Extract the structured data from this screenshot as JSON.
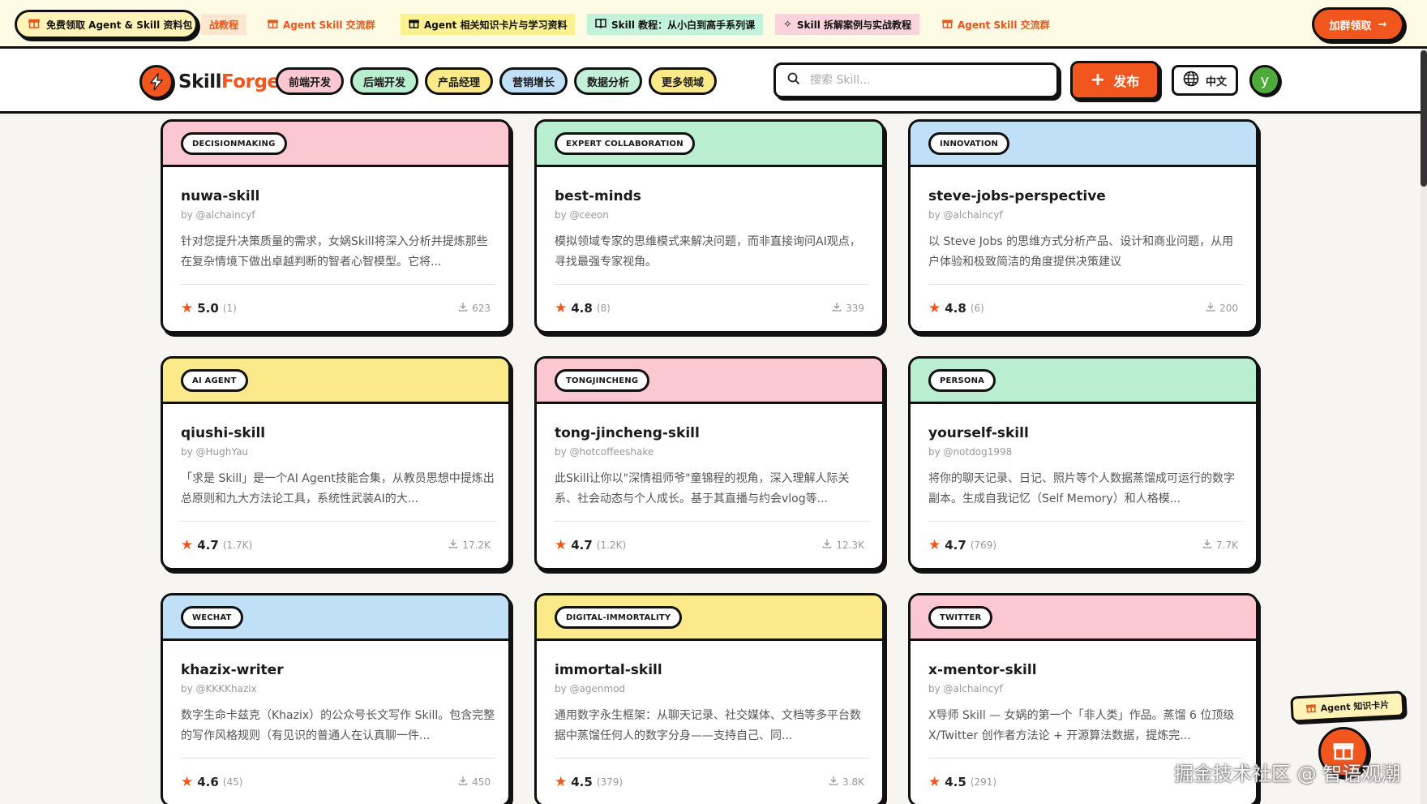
{
  "promo": {
    "primary_label": "免费领取 Agent & Skill 资料包",
    "items": [
      {
        "label": "战教程",
        "icon": "gift-icon",
        "bg": "#fde7d0",
        "color": "#e8551e"
      },
      {
        "label": "Agent Skill 交流群",
        "icon": "gift-icon",
        "bg": "transparent",
        "color": "#e8551e"
      },
      {
        "label": "Agent 相关知识卡片与学习资料",
        "icon": "gift-icon",
        "bg": "#fbf191",
        "color": "#111111"
      },
      {
        "label": "Skill 教程：从小白到高手系列课",
        "icon": "book-icon",
        "bg": "#c3f1d9",
        "color": "#111111"
      },
      {
        "label": "Skill 拆解案例与实战教程",
        "icon": "sparkle-icon",
        "bg": "#fbd3dc",
        "color": "#111111"
      },
      {
        "label": "Agent Skill 交流群",
        "icon": "gift-icon",
        "bg": "transparent",
        "color": "#e8551e"
      }
    ],
    "cta_label": "加群领取"
  },
  "header": {
    "logo_part1": "Skill",
    "logo_part2": "Forge",
    "categories": [
      {
        "label": "前端开发",
        "bg": "#fbc8d2"
      },
      {
        "label": "后端开发",
        "bg": "#b9eed1"
      },
      {
        "label": "产品经理",
        "bg": "#fbe98a"
      },
      {
        "label": "营销增长",
        "bg": "#bfe0f7"
      },
      {
        "label": "数据分析",
        "bg": "#c3f0d6"
      },
      {
        "label": "更多领域",
        "bg": "#fbe98a"
      }
    ],
    "search_placeholder": "搜索 Skill...",
    "publish_label": "发布",
    "lang_label": "中文",
    "avatar_initial": "y"
  },
  "cards": [
    {
      "tag": "DECISIONMAKING",
      "color": "#fbc8d2",
      "title": "nuwa-skill",
      "author": "by @alchaincyf",
      "desc": "针对您提升决策质量的需求，女娲Skill将深入分析并提炼那些在复杂情境下做出卓越判断的智者心智模型。它将...",
      "rating": "5.0",
      "count": "(1)",
      "downloads": "623"
    },
    {
      "tag": "EXPERT COLLABORATION",
      "color": "#b9eed1",
      "title": "best-minds",
      "author": "by @ceeon",
      "desc": "模拟领域专家的思维模式来解决问题，而非直接询问AI观点，寻找最强专家视角。",
      "rating": "4.8",
      "count": "(8)",
      "downloads": "339"
    },
    {
      "tag": "INNOVATION",
      "color": "#bfe0f7",
      "title": "steve-jobs-perspective",
      "author": "by @alchaincyf",
      "desc": "以 Steve Jobs 的思维方式分析产品、设计和商业问题，从用户体验和极致简洁的角度提供决策建议",
      "rating": "4.8",
      "count": "(6)",
      "downloads": "200"
    },
    {
      "tag": "AI AGENT",
      "color": "#fbe98a",
      "title": "qiushi-skill",
      "author": "by @HughYau",
      "desc": "「求是 Skill」是一个AI Agent技能合集，从教员思想中提炼出总原则和九大方法论工具，系统性武装AI的大...",
      "rating": "4.7",
      "count": "(1.7K)",
      "downloads": "17.2K"
    },
    {
      "tag": "TONGJINCHENG",
      "color": "#fbc8d2",
      "title": "tong-jincheng-skill",
      "author": "by @hotcoffeeshake",
      "desc": "此Skill让你以\"深情祖师爷\"童锦程的视角，深入理解人际关系、社会动态与个人成长。基于其直播与约会vlog等...",
      "rating": "4.7",
      "count": "(1.2K)",
      "downloads": "12.3K"
    },
    {
      "tag": "PERSONA",
      "color": "#b9eed1",
      "title": "yourself-skill",
      "author": "by @notdog1998",
      "desc": "将你的聊天记录、日记、照片等个人数据蒸馏成可运行的数字副本。生成自我记忆（Self Memory）和人格模...",
      "rating": "4.7",
      "count": "(769)",
      "downloads": "7.7K"
    },
    {
      "tag": "WECHAT",
      "color": "#bfe0f7",
      "title": "khazix-writer",
      "author": "by @KKKKhazix",
      "desc": "数字生命卡兹克（Khazix）的公众号长文写作 Skill。包含完整的写作风格规则（有见识的普通人在认真聊一件...",
      "rating": "4.6",
      "count": "(45)",
      "downloads": "450"
    },
    {
      "tag": "DIGITAL-IMMORTALITY",
      "color": "#fbe98a",
      "title": "immortal-skill",
      "author": "by @agenmod",
      "desc": "通用数字永生框架：从聊天记录、社交媒体、文档等多平台数据中蒸馏任何人的数字分身——支持自己、同...",
      "rating": "4.5",
      "count": "(379)",
      "downloads": "3.8K"
    },
    {
      "tag": "TWITTER",
      "color": "#fbc8d2",
      "title": "x-mentor-skill",
      "author": "by @alchaincyf",
      "desc": "X导师 Skill — 女娲的第一个「非人类」作品。蒸馏 6 位顶级 X/Twitter 创作者方法论 + 开源算法数据，提炼完...",
      "rating": "4.5",
      "count": "(291)",
      "downloads": ""
    }
  ],
  "floating": {
    "badge_label": "Agent 知识卡片"
  },
  "watermark": "掘金技术社区 @ 智语观潮"
}
